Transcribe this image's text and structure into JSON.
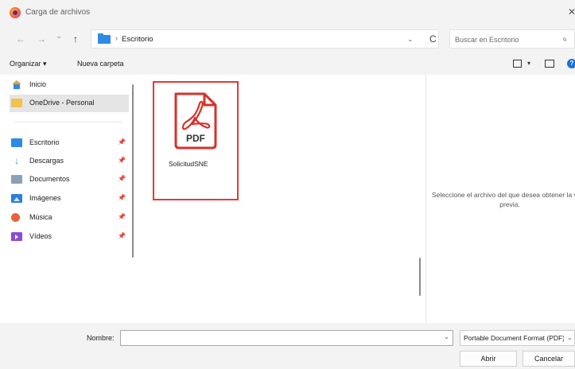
{
  "window": {
    "title": "Carga de archivos",
    "close_glyph": "✕"
  },
  "navigation": {
    "back": "←",
    "forward": "→",
    "recent": "⌄",
    "up": "↑"
  },
  "address": {
    "separator": "›",
    "crumb": "Escritorio",
    "dropdown": "⌄",
    "refresh": "C"
  },
  "search": {
    "placeholder": "Buscar en Escritorio",
    "icon": "⌕"
  },
  "toolbar": {
    "organize_label": "Organizar ▾",
    "new_folder_label": "Nueva carpeta",
    "view_dropdown": "▾",
    "help": "?"
  },
  "sidebar": {
    "pin": "📌",
    "items": [
      {
        "label": "Inicio",
        "icon": "home-icon"
      },
      {
        "label": "OneDrive - Personal",
        "icon": "onedrive-folder-icon"
      },
      {
        "label": "Escritorio",
        "icon": "desktop-icon"
      },
      {
        "label": "Descargas",
        "icon": "download-icon"
      },
      {
        "label": "Documentos",
        "icon": "documents-icon"
      },
      {
        "label": "Imágenes",
        "icon": "images-icon"
      },
      {
        "label": "Música",
        "icon": "music-icon"
      },
      {
        "label": "Vídeos",
        "icon": "videos-icon"
      }
    ]
  },
  "files": [
    {
      "name": "SolicitudSNE",
      "icon_text": "PDF"
    }
  ],
  "preview": {
    "message": "Seleccione el archivo del que desea obtener la vista previa."
  },
  "bottom": {
    "name_label": "Nombre:",
    "name_value": "",
    "name_dropdown": "⌄",
    "type_value": "Portable Document Format (PDF)",
    "type_dropdown": "⌄",
    "open_label": "Abrir",
    "cancel_label": "Cancelar"
  },
  "colors": {
    "highlight_border": "#e53935",
    "pdf_red": "#d9302a",
    "accent_blue": "#2e8ae6"
  }
}
